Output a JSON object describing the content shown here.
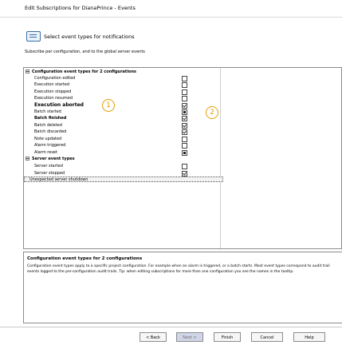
{
  "window": {
    "title": "Edit Subscriptions for DianaPrince - Events"
  },
  "header": {
    "icon": "notification-icon",
    "title": "Select event types for notifications",
    "subtitle": "Subscribe per configuration, and to the global server events"
  },
  "tree": {
    "groups": [
      {
        "label": "Configuration event types for 2 configurations",
        "expanded": true,
        "items": [
          {
            "label": "Configuration edited",
            "state": "unchecked"
          },
          {
            "label": "Execution started",
            "state": "unchecked"
          },
          {
            "label": "Execution stopped",
            "state": "unchecked"
          },
          {
            "label": "Execution resumed",
            "state": "unchecked"
          },
          {
            "label": "Execution aborted",
            "state": "checked"
          },
          {
            "label": "Batch started",
            "state": "partial"
          },
          {
            "label": "Batch finished",
            "state": "checked"
          },
          {
            "label": "Batch deleted",
            "state": "checked"
          },
          {
            "label": "Batch discarded",
            "state": "checked"
          },
          {
            "label": "Note updated",
            "state": "unchecked"
          },
          {
            "label": "Alarm triggered",
            "state": "unchecked"
          },
          {
            "label": "Alarm reset",
            "state": "partial"
          }
        ]
      },
      {
        "label": "Server event types",
        "expanded": true,
        "items": [
          {
            "label": "Server started",
            "state": "unchecked"
          },
          {
            "label": "Server stopped",
            "state": "checked"
          },
          {
            "label": "Unexpected server shutdown",
            "state": "unchecked"
          }
        ]
      }
    ],
    "callouts": [
      "1",
      "2"
    ]
  },
  "description": {
    "title": "Configuration event types for 2 configurations",
    "text": "Configuration event types apply to a specific project configuration. For example when an alarm is triggered, or a batch starts. Most event types correspond to audit trail events logged to the per-configuration audit trails. Tip: when editing subscriptions for more than one configuration you see the names in the tooltip."
  },
  "footer": {
    "back": "< Back",
    "next": "Next >",
    "finish": "Finish",
    "cancel": "Cancel",
    "help": "Help"
  },
  "colors": {
    "callout": "#e6a100",
    "disabled_button": "#cfd5e6"
  }
}
